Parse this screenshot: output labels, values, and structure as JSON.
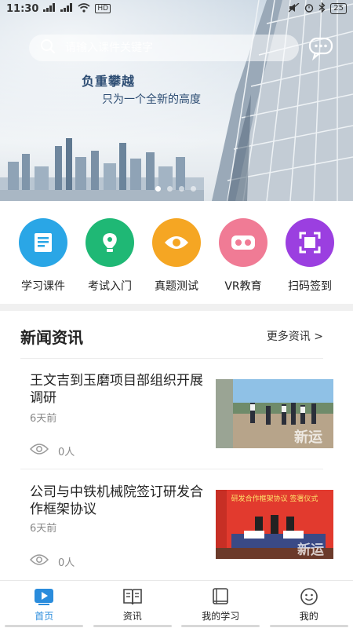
{
  "status_bar": {
    "time": "11:30",
    "signal": "5G",
    "network_badge": "HD",
    "battery": "25"
  },
  "search": {
    "placeholder": "请输入课件关键字"
  },
  "banner": {
    "slogan_main": "负重攀越",
    "slogan_sub": "只为一个全新的高度",
    "slide_count": 4,
    "active_slide": 0
  },
  "quick_actions": [
    {
      "label": "学习课件",
      "icon": "courseware-icon",
      "color": "#2aa6e6"
    },
    {
      "label": "考试入门",
      "icon": "pen-icon",
      "color": "#1fb875"
    },
    {
      "label": "真题测试",
      "icon": "eye-icon",
      "color": "#f5a623"
    },
    {
      "label": "VR教育",
      "icon": "vr-glasses-icon",
      "color": "#f07b95"
    },
    {
      "label": "扫码签到",
      "icon": "scan-icon",
      "color": "#9b3fe0"
    }
  ],
  "news": {
    "heading": "新闻资讯",
    "more_label": "更多资讯 >",
    "items": [
      {
        "title": "王文吉到玉磨项目部组织开展调研",
        "time": "6天前",
        "views": "0人"
      },
      {
        "title": "公司与中铁机械院签订研发合作框架协议",
        "time": "6天前",
        "views": "0人",
        "thumb_text": "研发合作框架协议 签署仪式"
      }
    ]
  },
  "bottom_nav": [
    {
      "label": "首页",
      "icon": "home-play-icon",
      "active": true
    },
    {
      "label": "资讯",
      "icon": "book-open-icon",
      "active": false
    },
    {
      "label": "我的学习",
      "icon": "notebook-icon",
      "active": false
    },
    {
      "label": "我的",
      "icon": "smile-icon",
      "active": false
    }
  ],
  "colors": {
    "accent": "#2a8cdc",
    "separator": "#f0f0f0"
  }
}
